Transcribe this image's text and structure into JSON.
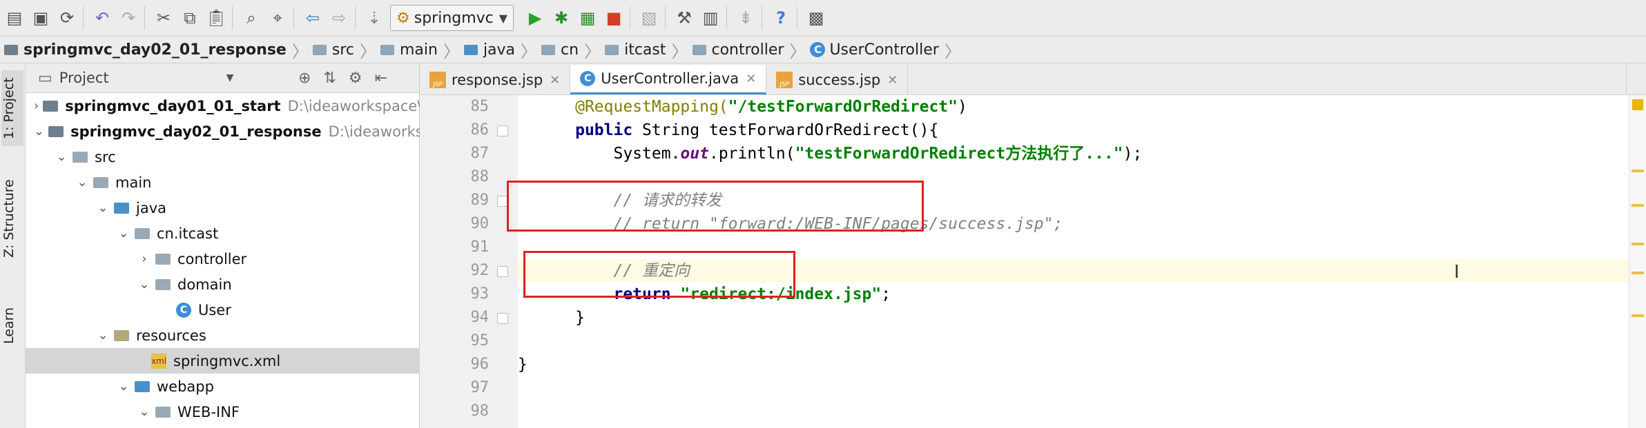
{
  "toolbar": {
    "run_config_label": "springmvc"
  },
  "breadcrumb": {
    "items": [
      "springmvc_day02_01_response",
      "src",
      "main",
      "java",
      "cn",
      "itcast",
      "controller",
      "UserController"
    ]
  },
  "left_strip": {
    "tabs": [
      "1: Project",
      "Z: Structure",
      "Learn"
    ]
  },
  "project_panel": {
    "title": "Project",
    "tree": [
      {
        "label": "springmvc_day01_01_start",
        "path": "D:\\ideaworkspace\\Id"
      },
      {
        "label": "springmvc_day02_01_response",
        "path": "D:\\ideaworkspa"
      },
      {
        "label": "src"
      },
      {
        "label": "main"
      },
      {
        "label": "java"
      },
      {
        "label": "cn.itcast"
      },
      {
        "label": "controller"
      },
      {
        "label": "domain"
      },
      {
        "label": "User"
      },
      {
        "label": "resources"
      },
      {
        "label": "springmvc.xml"
      },
      {
        "label": "webapp"
      },
      {
        "label": "WEB-INF"
      }
    ]
  },
  "editor": {
    "tabs": [
      {
        "label": "response.jsp",
        "icon": "jsp-file-icon"
      },
      {
        "label": "UserController.java",
        "icon": "class-icon"
      },
      {
        "label": "success.jsp",
        "icon": "jsp-file-icon"
      }
    ],
    "line_numbers": [
      "85",
      "86",
      "87",
      "88",
      "89",
      "90",
      "91",
      "92",
      "93",
      "94",
      "95",
      "96",
      "97",
      "98"
    ],
    "code": {
      "l85_ann": "@RequestMapping(",
      "l85_str": "\"/testForwardOrRedirect\"",
      "l85_end": ")",
      "l86_kw": "public ",
      "l86_rest": "String testForwardOrRedirect(){",
      "l87_a": "System.",
      "l87_field": "out",
      "l87_b": ".println(",
      "l87_str": "\"testForwardOrRedirect方法执行了...\"",
      "l87_end": ");",
      "l89_cmt": "// 请求的转发",
      "l90_cmt": "// return \"forward:/WEB-INF/pages/success.jsp\";",
      "l92_cmt": "// 重定向",
      "l93_kw": "return ",
      "l93_str": "\"redirect:/index.jsp\"",
      "l93_end": ";",
      "l94": "}",
      "l96": "}"
    }
  },
  "colors": {
    "annotation_box": "#e02020",
    "keyword": "#000080",
    "string": "#008000",
    "comment": "#808080"
  }
}
